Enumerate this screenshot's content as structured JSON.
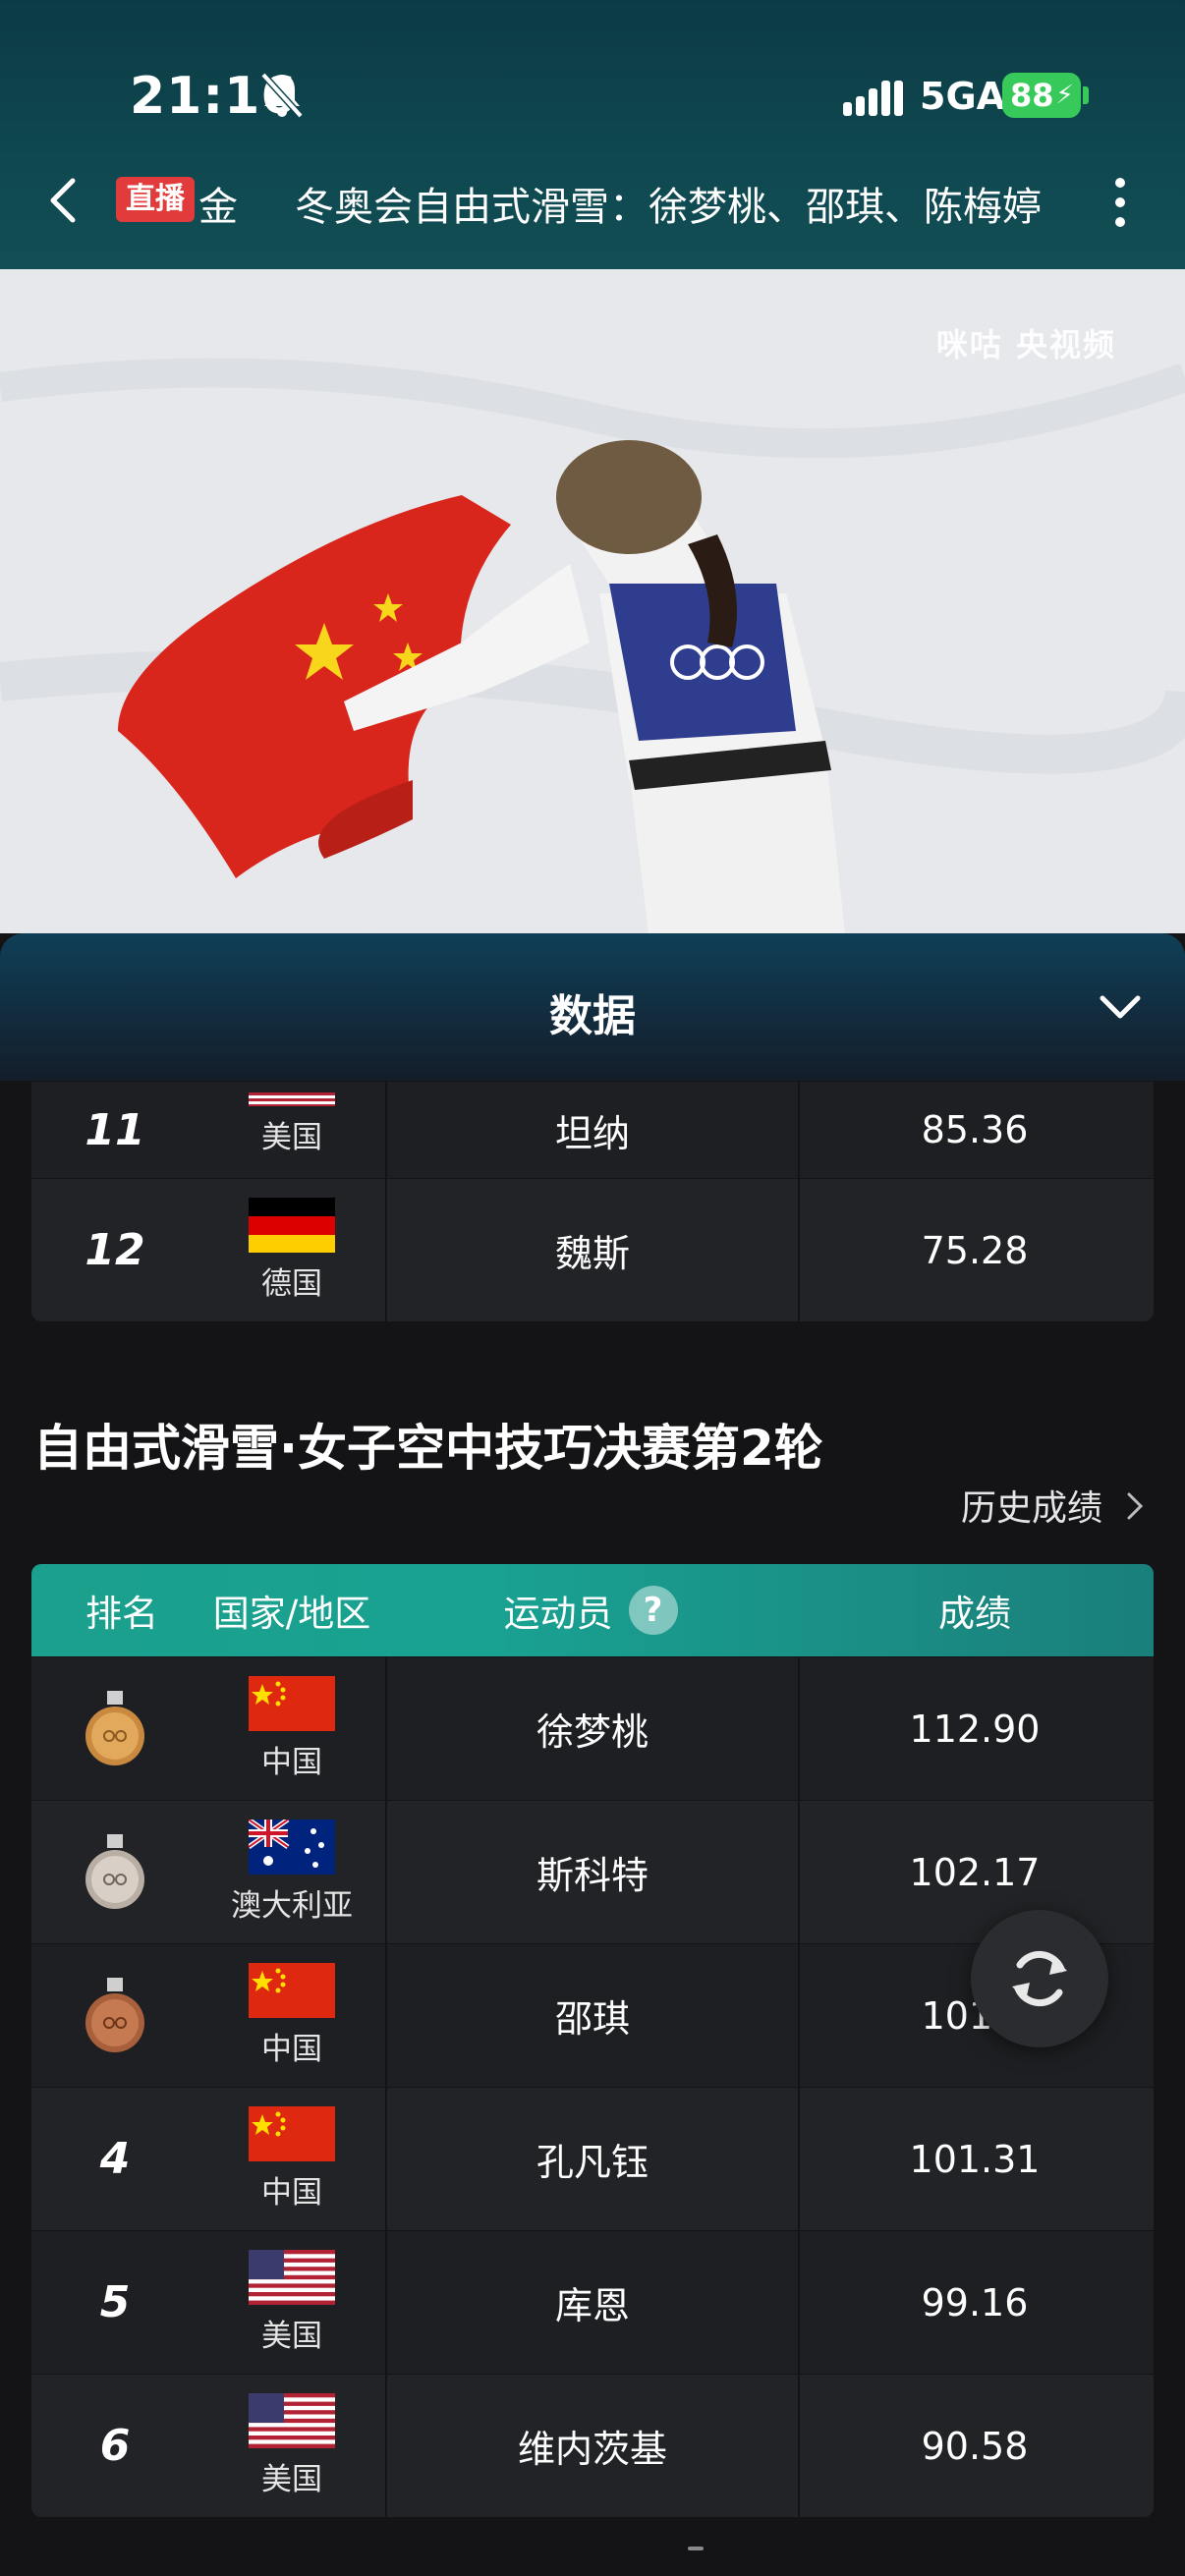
{
  "status_bar": {
    "time": "21:16",
    "network": "5GA",
    "battery": "88"
  },
  "nav": {
    "live_badge": "直播",
    "title_prefix": "金",
    "title": "冬奥会自由式滑雪：徐梦桃、邵琪、陈梅婷"
  },
  "video": {
    "watermark": "咪咕 央视频"
  },
  "panel": {
    "title": "数据"
  },
  "top_table": {
    "rows": [
      {
        "rank": "11",
        "country": "美国",
        "flag": "us-flag",
        "athlete": "坦纳",
        "score": "85.36"
      },
      {
        "rank": "12",
        "country": "德国",
        "flag": "germany-flag",
        "athlete": "魏斯",
        "score": "75.28"
      }
    ]
  },
  "section": {
    "title": "自由式滑雪·女子空中技巧决赛第2轮",
    "history_link": "历史成绩"
  },
  "final_table": {
    "headers": {
      "rank": "排名",
      "country": "国家/地区",
      "athlete": "运动员",
      "help": "?",
      "score": "成绩"
    },
    "rows": [
      {
        "rank": "",
        "medal": "gold-medal-icon",
        "country": "中国",
        "flag": "china-flag",
        "athlete": "徐梦桃",
        "score": "112.90"
      },
      {
        "rank": "",
        "medal": "silver-medal-icon",
        "country": "澳大利亚",
        "flag": "australia-flag",
        "athlete": "斯科特",
        "score": "102.17"
      },
      {
        "rank": "",
        "medal": "bronze-medal-icon",
        "country": "中国",
        "flag": "china-flag",
        "athlete": "邵琪",
        "score": "101.3"
      },
      {
        "rank": "4",
        "country": "中国",
        "flag": "china-flag",
        "athlete": "孔凡钰",
        "score": "101.31"
      },
      {
        "rank": "5",
        "country": "美国",
        "flag": "us-flag",
        "athlete": "库恩",
        "score": "99.16"
      },
      {
        "rank": "6",
        "country": "美国",
        "flag": "us-flag",
        "athlete": "维内茨基",
        "score": "90.58"
      }
    ]
  },
  "colors": {
    "accent": "#1aa08c",
    "live": "#e23b3b",
    "battery": "#37c95a"
  }
}
